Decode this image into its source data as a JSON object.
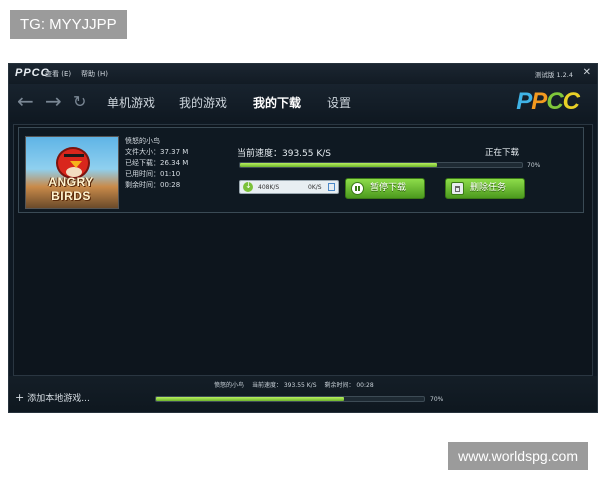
{
  "watermarks": {
    "top_left": "TG: MYYJJPP",
    "bottom_right": "www.worldspg.com"
  },
  "titlebar": {
    "logo": "PPCC",
    "menu": [
      "查看 (E)",
      "帮助 (H)"
    ],
    "version": "测试版 1.2.4",
    "close_icon": "close-x"
  },
  "nav": {
    "back_icon": "arrow-left",
    "forward_icon": "arrow-right",
    "refresh_icon": "refresh",
    "tabs": [
      "单机游戏",
      "我的游戏",
      "我的下载",
      "设置"
    ],
    "active_tab": "我的下载",
    "brand": {
      "p1": "P",
      "p2": "P",
      "c1": "C",
      "c2": "C"
    }
  },
  "download": {
    "thumbnail_logo": "ANGRY BIRDS",
    "game_title": "愤怒的小鸟",
    "file_size_label": "文件大小：",
    "file_size": "37.37 M",
    "downloaded_label": "已经下载：",
    "downloaded": "26.34 M",
    "elapsed_label": "已用时间：",
    "elapsed": "01:10",
    "remaining_label": "剩余时间：",
    "remaining": "00:28",
    "speed_label": "当前速度：393.55 K/S",
    "status": "正在下载",
    "progress_percent": 70,
    "progress_text": "70%",
    "down_rate": "408K/S",
    "up_rate": "0K/S",
    "pause_button": "暂停下载",
    "delete_button": "删除任务"
  },
  "footer": {
    "add_local": "添加本地游戏...",
    "game": "愤怒的小鸟",
    "speed": "当前速度： 393.55 K/S",
    "remaining": "剩余时间： 00:28",
    "progress_percent": 70,
    "progress_text": "70%"
  },
  "colors": {
    "accent_green": "#7bc13a",
    "app_bg": "#0f1923"
  }
}
